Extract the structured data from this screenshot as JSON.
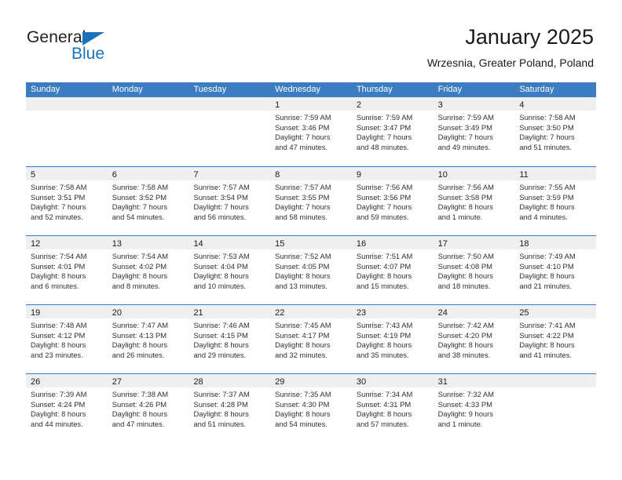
{
  "brand": {
    "name_part1": "General",
    "name_part2": "Blue",
    "triangle_color": "#1c72ba",
    "text_color": "#231f20"
  },
  "header": {
    "title": "January 2025",
    "subtitle": "Wrzesnia, Greater Poland, Poland"
  },
  "theme": {
    "header_blue": "#3b7dc0",
    "daynum_bar": "#efefef",
    "text": "#1a1a1a"
  },
  "calendar": {
    "weekdays": [
      "Sunday",
      "Monday",
      "Tuesday",
      "Wednesday",
      "Thursday",
      "Friday",
      "Saturday"
    ],
    "weeks": [
      [
        {
          "day": "",
          "lines": []
        },
        {
          "day": "",
          "lines": []
        },
        {
          "day": "",
          "lines": []
        },
        {
          "day": "1",
          "lines": [
            "Sunrise: 7:59 AM",
            "Sunset: 3:46 PM",
            "Daylight: 7 hours",
            "and 47 minutes."
          ]
        },
        {
          "day": "2",
          "lines": [
            "Sunrise: 7:59 AM",
            "Sunset: 3:47 PM",
            "Daylight: 7 hours",
            "and 48 minutes."
          ]
        },
        {
          "day": "3",
          "lines": [
            "Sunrise: 7:59 AM",
            "Sunset: 3:49 PM",
            "Daylight: 7 hours",
            "and 49 minutes."
          ]
        },
        {
          "day": "4",
          "lines": [
            "Sunrise: 7:58 AM",
            "Sunset: 3:50 PM",
            "Daylight: 7 hours",
            "and 51 minutes."
          ]
        }
      ],
      [
        {
          "day": "5",
          "lines": [
            "Sunrise: 7:58 AM",
            "Sunset: 3:51 PM",
            "Daylight: 7 hours",
            "and 52 minutes."
          ]
        },
        {
          "day": "6",
          "lines": [
            "Sunrise: 7:58 AM",
            "Sunset: 3:52 PM",
            "Daylight: 7 hours",
            "and 54 minutes."
          ]
        },
        {
          "day": "7",
          "lines": [
            "Sunrise: 7:57 AM",
            "Sunset: 3:54 PM",
            "Daylight: 7 hours",
            "and 56 minutes."
          ]
        },
        {
          "day": "8",
          "lines": [
            "Sunrise: 7:57 AM",
            "Sunset: 3:55 PM",
            "Daylight: 7 hours",
            "and 58 minutes."
          ]
        },
        {
          "day": "9",
          "lines": [
            "Sunrise: 7:56 AM",
            "Sunset: 3:56 PM",
            "Daylight: 7 hours",
            "and 59 minutes."
          ]
        },
        {
          "day": "10",
          "lines": [
            "Sunrise: 7:56 AM",
            "Sunset: 3:58 PM",
            "Daylight: 8 hours",
            "and 1 minute."
          ]
        },
        {
          "day": "11",
          "lines": [
            "Sunrise: 7:55 AM",
            "Sunset: 3:59 PM",
            "Daylight: 8 hours",
            "and 4 minutes."
          ]
        }
      ],
      [
        {
          "day": "12",
          "lines": [
            "Sunrise: 7:54 AM",
            "Sunset: 4:01 PM",
            "Daylight: 8 hours",
            "and 6 minutes."
          ]
        },
        {
          "day": "13",
          "lines": [
            "Sunrise: 7:54 AM",
            "Sunset: 4:02 PM",
            "Daylight: 8 hours",
            "and 8 minutes."
          ]
        },
        {
          "day": "14",
          "lines": [
            "Sunrise: 7:53 AM",
            "Sunset: 4:04 PM",
            "Daylight: 8 hours",
            "and 10 minutes."
          ]
        },
        {
          "day": "15",
          "lines": [
            "Sunrise: 7:52 AM",
            "Sunset: 4:05 PM",
            "Daylight: 8 hours",
            "and 13 minutes."
          ]
        },
        {
          "day": "16",
          "lines": [
            "Sunrise: 7:51 AM",
            "Sunset: 4:07 PM",
            "Daylight: 8 hours",
            "and 15 minutes."
          ]
        },
        {
          "day": "17",
          "lines": [
            "Sunrise: 7:50 AM",
            "Sunset: 4:08 PM",
            "Daylight: 8 hours",
            "and 18 minutes."
          ]
        },
        {
          "day": "18",
          "lines": [
            "Sunrise: 7:49 AM",
            "Sunset: 4:10 PM",
            "Daylight: 8 hours",
            "and 21 minutes."
          ]
        }
      ],
      [
        {
          "day": "19",
          "lines": [
            "Sunrise: 7:48 AM",
            "Sunset: 4:12 PM",
            "Daylight: 8 hours",
            "and 23 minutes."
          ]
        },
        {
          "day": "20",
          "lines": [
            "Sunrise: 7:47 AM",
            "Sunset: 4:13 PM",
            "Daylight: 8 hours",
            "and 26 minutes."
          ]
        },
        {
          "day": "21",
          "lines": [
            "Sunrise: 7:46 AM",
            "Sunset: 4:15 PM",
            "Daylight: 8 hours",
            "and 29 minutes."
          ]
        },
        {
          "day": "22",
          "lines": [
            "Sunrise: 7:45 AM",
            "Sunset: 4:17 PM",
            "Daylight: 8 hours",
            "and 32 minutes."
          ]
        },
        {
          "day": "23",
          "lines": [
            "Sunrise: 7:43 AM",
            "Sunset: 4:19 PM",
            "Daylight: 8 hours",
            "and 35 minutes."
          ]
        },
        {
          "day": "24",
          "lines": [
            "Sunrise: 7:42 AM",
            "Sunset: 4:20 PM",
            "Daylight: 8 hours",
            "and 38 minutes."
          ]
        },
        {
          "day": "25",
          "lines": [
            "Sunrise: 7:41 AM",
            "Sunset: 4:22 PM",
            "Daylight: 8 hours",
            "and 41 minutes."
          ]
        }
      ],
      [
        {
          "day": "26",
          "lines": [
            "Sunrise: 7:39 AM",
            "Sunset: 4:24 PM",
            "Daylight: 8 hours",
            "and 44 minutes."
          ]
        },
        {
          "day": "27",
          "lines": [
            "Sunrise: 7:38 AM",
            "Sunset: 4:26 PM",
            "Daylight: 8 hours",
            "and 47 minutes."
          ]
        },
        {
          "day": "28",
          "lines": [
            "Sunrise: 7:37 AM",
            "Sunset: 4:28 PM",
            "Daylight: 8 hours",
            "and 51 minutes."
          ]
        },
        {
          "day": "29",
          "lines": [
            "Sunrise: 7:35 AM",
            "Sunset: 4:30 PM",
            "Daylight: 8 hours",
            "and 54 minutes."
          ]
        },
        {
          "day": "30",
          "lines": [
            "Sunrise: 7:34 AM",
            "Sunset: 4:31 PM",
            "Daylight: 8 hours",
            "and 57 minutes."
          ]
        },
        {
          "day": "31",
          "lines": [
            "Sunrise: 7:32 AM",
            "Sunset: 4:33 PM",
            "Daylight: 9 hours",
            "and 1 minute."
          ]
        },
        {
          "day": "",
          "lines": []
        }
      ]
    ]
  }
}
